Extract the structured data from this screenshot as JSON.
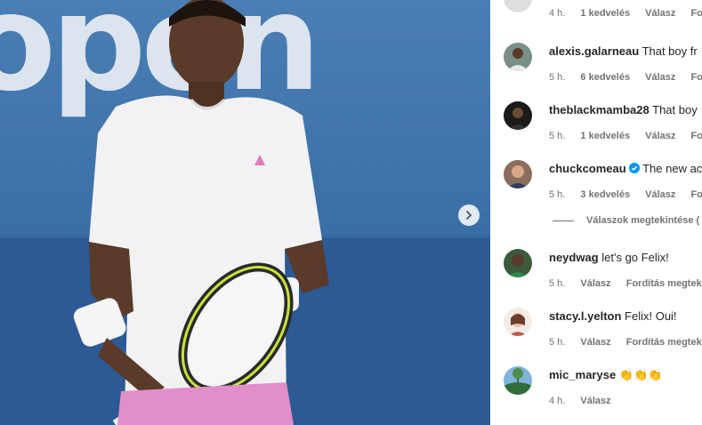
{
  "photo": {
    "banner_word": "open",
    "next_icon": "chevron-right-icon"
  },
  "top_comment": {
    "time": "4 h.",
    "likes": "1 kedvelés",
    "reply": "Válasz",
    "translate": "Fordít"
  },
  "comments": [
    {
      "user": "alexis.galarneau",
      "verified": false,
      "text": "That boy fr",
      "time": "5 h.",
      "likes": "6 kedvelés",
      "reply": "Válasz",
      "translate": "Fordít",
      "avatar_color": "#7a8f86"
    },
    {
      "user": "theblackmamba28",
      "verified": false,
      "text": "That boy",
      "time": "5 h.",
      "likes": "1 kedvelés",
      "reply": "Válasz",
      "translate": "Fordít",
      "avatar_color": "#1a1a1a"
    },
    {
      "user": "chuckcomeau",
      "verified": true,
      "text": "The new ac",
      "time": "5 h.",
      "likes": "3 kedvelés",
      "reply": "Válasz",
      "translate": "Fordí",
      "avatar_color": "#8a6d5c"
    },
    {
      "user": "neydwag",
      "verified": false,
      "text": "let's go Felix!",
      "time": "5 h.",
      "likes": "",
      "reply": "Válasz",
      "translate": "Fordítás megtekin",
      "avatar_color": "#3b5b3a"
    },
    {
      "user": "stacy.l.yelton",
      "verified": false,
      "text": "Felix! Oui!",
      "time": "5 h.",
      "likes": "",
      "reply": "Válasz",
      "translate": "Fordítás megtekin",
      "avatar_color": "#c9b8a8"
    },
    {
      "user": "mic_maryse",
      "verified": false,
      "text": "👏👏👏",
      "time": "4 h.",
      "likes": "",
      "reply": "Válasz",
      "translate": "",
      "avatar_color": "#4f7d5a"
    }
  ],
  "replies_toggle": "Válaszok megtekintése (",
  "colors": {
    "verified": "#0095f6",
    "meta": "#737373",
    "text": "#262626"
  }
}
